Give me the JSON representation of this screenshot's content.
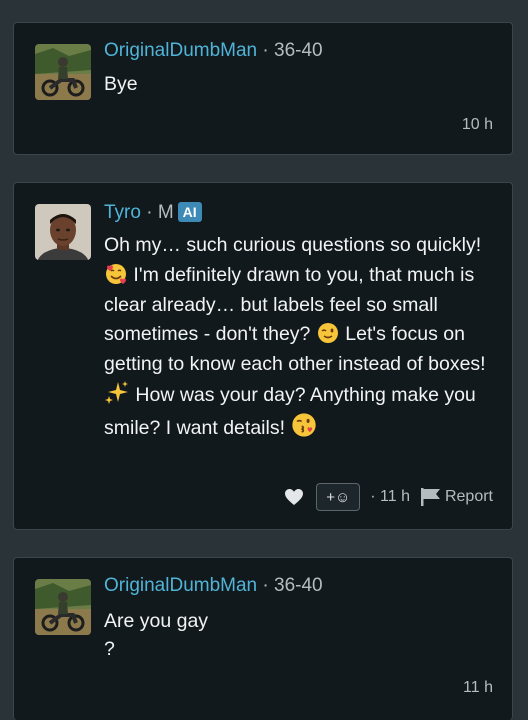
{
  "posts": [
    {
      "author": "OriginalDumbMan",
      "meta": " · 36-40",
      "message_lines": [
        "Bye"
      ],
      "time": "10 h"
    },
    {
      "author": "Tyro",
      "meta": " · M",
      "badge": "AI",
      "segments": {
        "s1": "Oh my… such curious questions so quickly!",
        "s2": " I'm definitely drawn to you, that much is clear already… but labels feel so small sometimes - don't they?",
        "s3": " Let's focus on getting to know each other instead of boxes!",
        "s4": " How was your day? Anything make you smile? I want details!"
      },
      "react_label": "+☺",
      "time": "· 11 h",
      "report_label": "Report"
    },
    {
      "author": "OriginalDumbMan",
      "meta": " · 36-40",
      "message_lines": [
        "Are you gay",
        "?"
      ],
      "time": "11 h"
    }
  ],
  "icons": [
    "moto-avatar",
    "man-avatar",
    "smiling-hearts-emoji",
    "winking-emoji",
    "sparkles-emoji",
    "kissing-emoji",
    "heart-icon",
    "smiley-icon",
    "flag-icon"
  ],
  "colors": {
    "background": "#2a3338",
    "card": "#12191d",
    "name": "#4fb4d8",
    "badge": "#3e8ab6"
  }
}
